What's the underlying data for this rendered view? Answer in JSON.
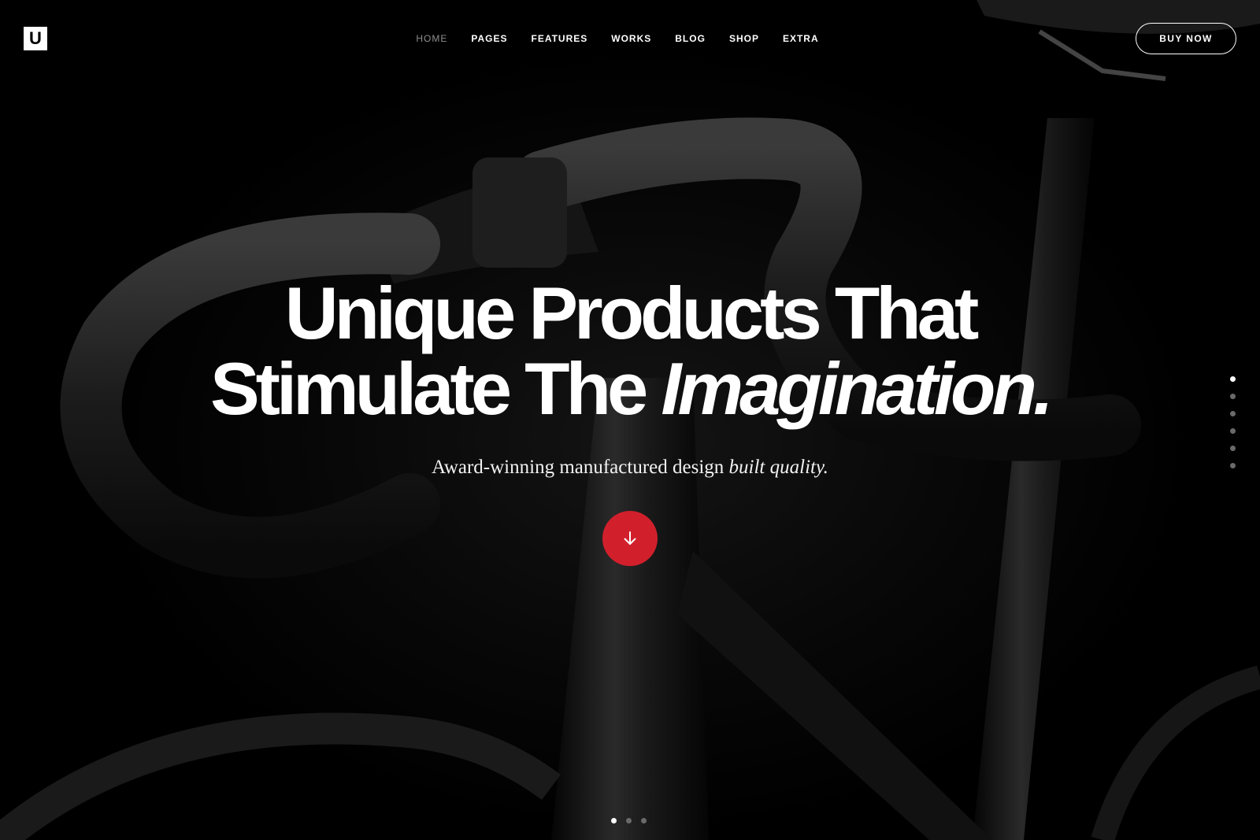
{
  "logo": {
    "letter": "U"
  },
  "nav": {
    "items": [
      {
        "label": "HOME",
        "active": true
      },
      {
        "label": "PAGES"
      },
      {
        "label": "FEATURES"
      },
      {
        "label": "WORKS"
      },
      {
        "label": "BLOG"
      },
      {
        "label": "SHOP"
      },
      {
        "label": "EXTRA"
      }
    ]
  },
  "header": {
    "buy_label": "BUY NOW"
  },
  "hero": {
    "headline_line1": "Unique Products That",
    "headline_line2_plain": "Stimulate The ",
    "headline_line2_italic": "Imagination.",
    "subtitle_plain": "Award-winning manufactured design ",
    "subtitle_italic": "built quality.",
    "background_icon": "bicycle-photo",
    "scroll_icon": "arrow-down-icon"
  },
  "pagination": {
    "side_dots": 6,
    "side_active": 1,
    "bottom_dots": 3,
    "bottom_active": 1
  },
  "colors": {
    "accent": "#d1202c",
    "background": "#000000",
    "text": "#ffffff",
    "nav_active": "#8e8e8e"
  }
}
